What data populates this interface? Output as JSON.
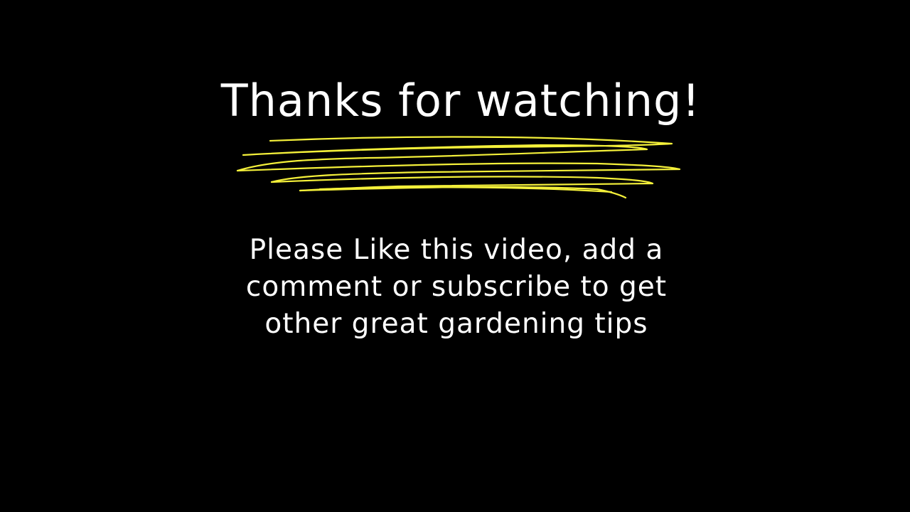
{
  "slide": {
    "title": "Thanks for watching!",
    "message_lines": [
      "Please Like this video, add a",
      "comment or subscribe to get",
      "other great gardening tips"
    ]
  },
  "colors": {
    "background": "#000000",
    "text": "#ffffff",
    "highlight": "#f4f03a"
  }
}
